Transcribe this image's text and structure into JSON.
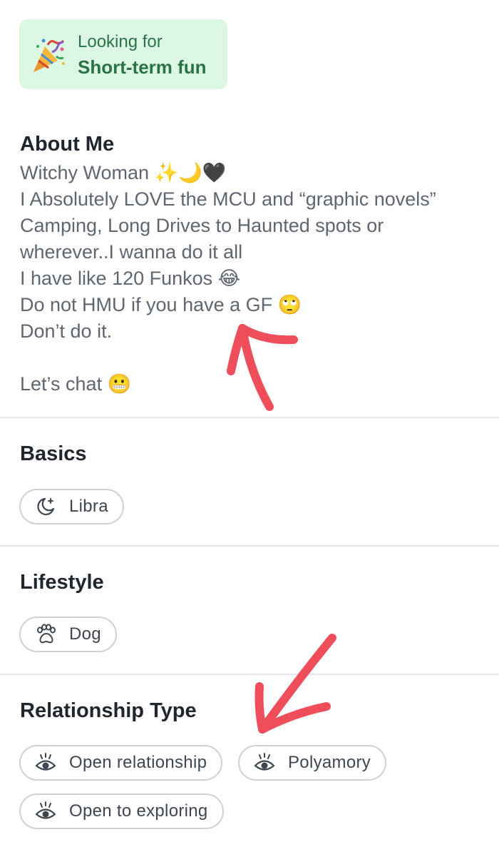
{
  "looking_for": {
    "icon": "party-popper-icon",
    "label": "Looking for",
    "value": "Short-term fun"
  },
  "about": {
    "title": "About Me",
    "lines": [
      "Witchy Woman ✨🌙🖤",
      "I Absolutely LOVE the MCU and “graphic novels”",
      "Camping, Long Drives to Haunted spots or",
      "wherever..I wanna do it all",
      "I have like 120 Funkos 😂",
      "Do not HMU if you have a GF 🙄",
      "Don’t do it.",
      "",
      "Let’s chat 😬"
    ]
  },
  "basics": {
    "title": "Basics",
    "tags": [
      {
        "label": "Libra",
        "icon": "moon-stars-icon"
      }
    ]
  },
  "lifestyle": {
    "title": "Lifestyle",
    "tags": [
      {
        "label": "Dog",
        "icon": "paw-icon"
      }
    ]
  },
  "relationship_type": {
    "title": "Relationship Type",
    "tags": [
      {
        "label": "Open relationship",
        "icon": "eye-icon"
      },
      {
        "label": "Polyamory",
        "icon": "eye-icon"
      },
      {
        "label": "Open to exploring",
        "icon": "eye-icon"
      }
    ]
  },
  "annotations": {
    "arrow_color": "#ef4d5a"
  },
  "colors": {
    "looking_bg": "#dcf7e3",
    "looking_text": "#2b7347",
    "body_text": "#5f6670",
    "heading_text": "#21262e",
    "pill_border": "#cdd1d6"
  }
}
